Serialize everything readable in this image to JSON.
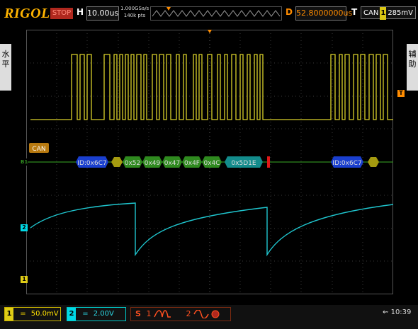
{
  "topbar": {
    "logo": "RIGOL",
    "run_state": "STOP",
    "h_label": "H",
    "timebase": "10.00us",
    "sample_rate": "1.000GSa/s",
    "memory_depth": "140k pts",
    "d_label": "D",
    "delay": "52.8000000us",
    "t_label": "T",
    "trigger_source": "CAN",
    "trigger_channel": "1",
    "trigger_level": "285mV"
  },
  "side_tabs": {
    "left": "水\n平",
    "right": "辅\n助"
  },
  "decode": {
    "protocol_label": "CAN",
    "bus_marker": "B1",
    "frames": [
      {
        "label": "ID:0x6C7",
        "type": "id"
      },
      {
        "label": "",
        "type": "dlc"
      },
      {
        "label": "0x52",
        "type": "data"
      },
      {
        "label": "0x49",
        "type": "data"
      },
      {
        "label": "0x47",
        "type": "data"
      },
      {
        "label": "0x4F",
        "type": "data"
      },
      {
        "label": "0x4C",
        "type": "data"
      },
      {
        "label": "0x5D1E",
        "type": "crc"
      },
      {
        "label": "ID:0x6C7",
        "type": "id"
      },
      {
        "label": "",
        "type": "dlc"
      }
    ]
  },
  "channel_markers": {
    "ch2": "2",
    "ch1": "1",
    "trigger": "T"
  },
  "bottombar": {
    "ch1_num": "1",
    "ch1_coupling": "=",
    "ch1_scale": "50.0mV",
    "ch2_num": "2",
    "ch2_coupling": "=",
    "ch2_scale": "2.00V",
    "math_label": "S",
    "math_ch": "1",
    "math_ch2": "2",
    "time": "10:39"
  },
  "colors": {
    "ch1": "#d9d02a",
    "ch2": "#1fc6cf",
    "decode_id": "#1a3fcf",
    "decode_data": "#2f8a1f",
    "decode_crc": "#138c8c",
    "decode_dlc": "#a59b10",
    "accent_orange": "#ff8c00"
  }
}
